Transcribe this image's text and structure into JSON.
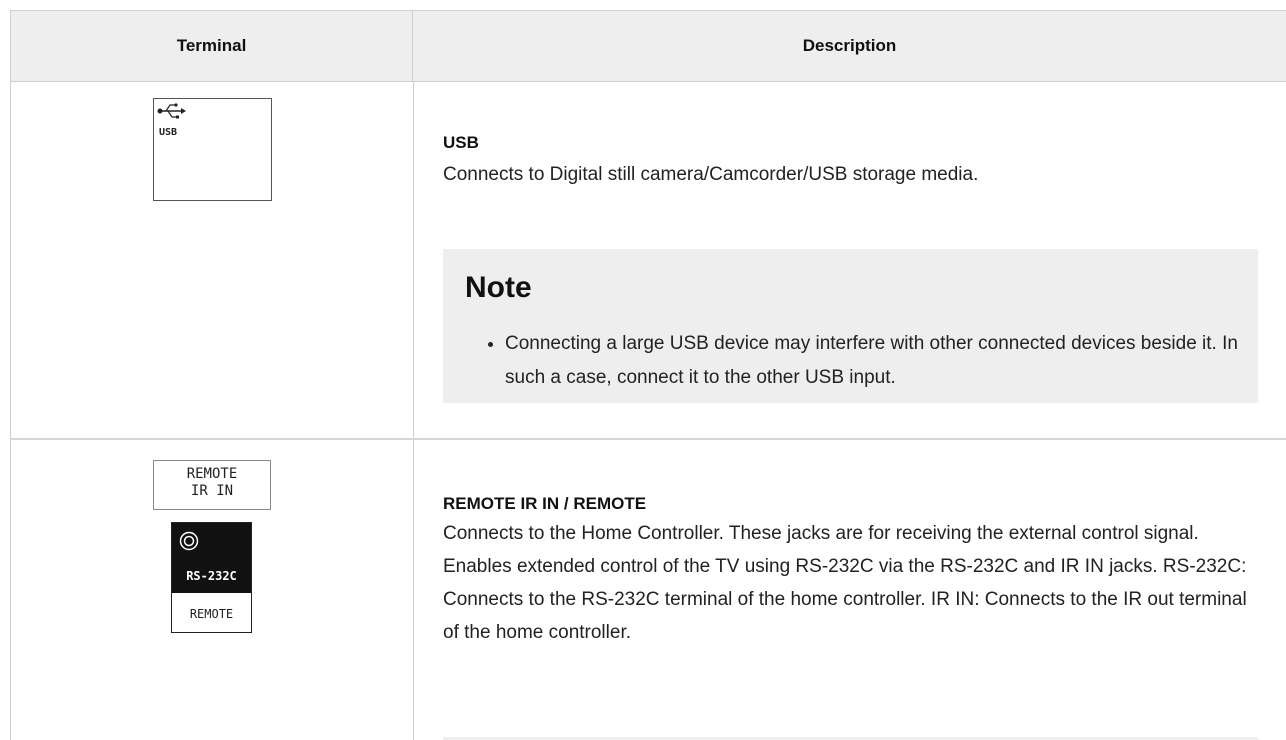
{
  "table": {
    "header_terminal": "Terminal",
    "header_description": "Description"
  },
  "rows": [
    {
      "icon_label": "USB",
      "title": "USB",
      "description": "Connects to Digital still camera/Camcorder/USB storage media.",
      "note_title": "Note",
      "note_items": [
        "Connecting a large USB device may interfere with other connected devices beside it. In such a case, connect it to the other USB input."
      ]
    },
    {
      "icon_label_line1": "REMOTE",
      "icon_label_line2": "IR IN",
      "icon_rs_label": "RS-232C",
      "icon_remote_label": "REMOTE",
      "title": "REMOTE IR IN / REMOTE",
      "description": "Connects to the Home Controller. These jacks are for receiving the external control signal. Enables extended control of the TV using RS-232C via the RS-232C and IR IN jacks. RS-232C: Connects to the RS-232C terminal of the home controller. IR IN: Connects to the IR out terminal of the home controller."
    }
  ],
  "colors": {
    "header_bg": "#eeeeee",
    "note_bg": "#eeeeee",
    "border": "#cfcfcf"
  }
}
